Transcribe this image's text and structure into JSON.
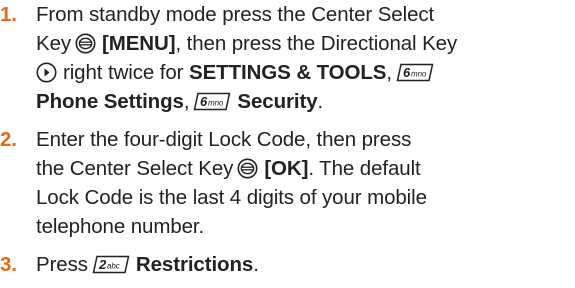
{
  "steps": [
    {
      "number": "1.",
      "text": {
        "a": "From standby mode press the Center Select",
        "b": "Key",
        "c": "[MENU]",
        "d": ", then press the Directional Key",
        "e": "right twice for",
        "f": "SETTINGS & TOOLS",
        "g": ",",
        "h": "Phone Settings",
        "i": ",",
        "j": "Security",
        "k": "."
      },
      "icons": [
        "center-select-key-icon",
        "directional-key-right-icon",
        "key-6-mno-icon",
        "key-6-mno-icon"
      ]
    },
    {
      "number": "2.",
      "text": {
        "a": "Enter the four-digit Lock Code, then press",
        "b": "the Center Select Key",
        "c": "[OK]",
        "d": ". The default",
        "e": "Lock Code is the last 4 digits of your mobile",
        "f": "telephone number."
      },
      "icons": [
        "center-select-key-icon"
      ]
    },
    {
      "number": "3.",
      "text": {
        "a": "Press",
        "b": "Restrictions",
        "c": "."
      },
      "icons": [
        "key-2-abc-icon"
      ]
    }
  ],
  "key_labels": {
    "mno": "6mno",
    "abc": "2abc"
  },
  "colors": {
    "step_number": "#e5681c",
    "text": "#222222"
  }
}
